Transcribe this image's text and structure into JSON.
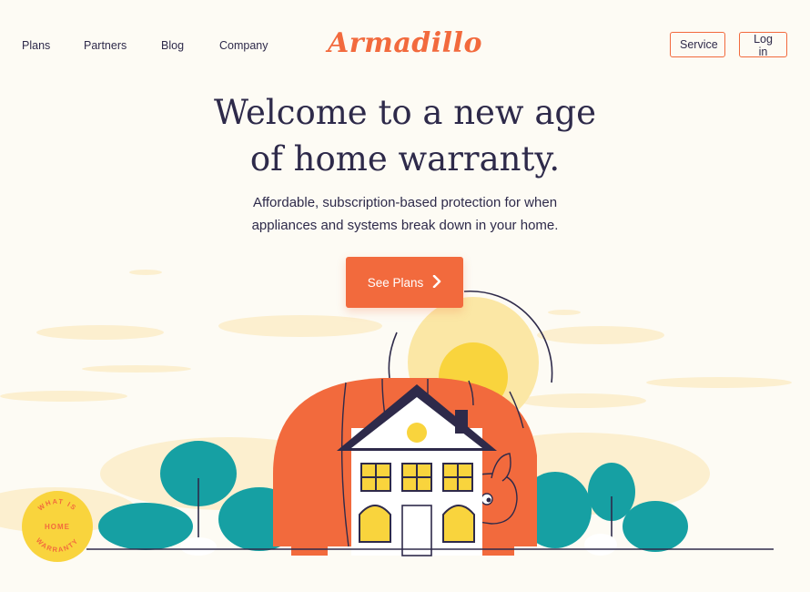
{
  "nav": {
    "links": [
      "Plans",
      "Partners",
      "Blog",
      "Company"
    ],
    "logo": "Armadillo",
    "service_label": "Service",
    "login_label": "Log in"
  },
  "hero": {
    "headline_line1": "Welcome to a new age",
    "headline_line2": "of home warranty.",
    "subtext_line1": "Affordable, subscription-based protection for when",
    "subtext_line2": "appliances and systems break down in your home.",
    "cta_label": "See Plans"
  },
  "badge": {
    "line1": "WHAT IS",
    "line2": "HOME",
    "line3": "WARRANTY"
  },
  "colors": {
    "accent": "#f26a3d",
    "text": "#2e2a4a",
    "background": "#fdfbf4",
    "sun": "#f9d43d",
    "tree": "#16a0a3"
  }
}
